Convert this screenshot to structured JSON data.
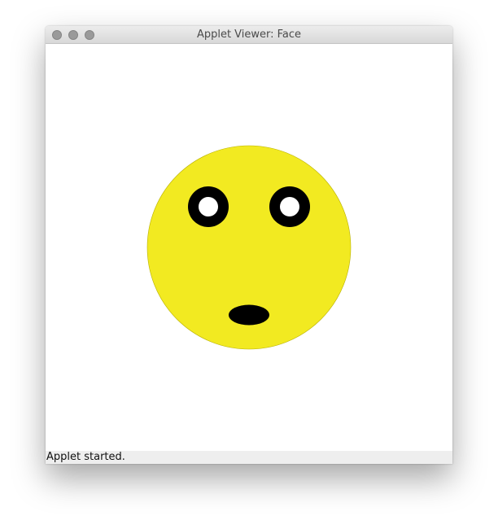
{
  "window": {
    "title": "Applet Viewer: Face"
  },
  "status": {
    "text": "Applet started."
  },
  "colors": {
    "face": "#f2ea21",
    "features": "#000000",
    "pupil": "#ffffff"
  }
}
